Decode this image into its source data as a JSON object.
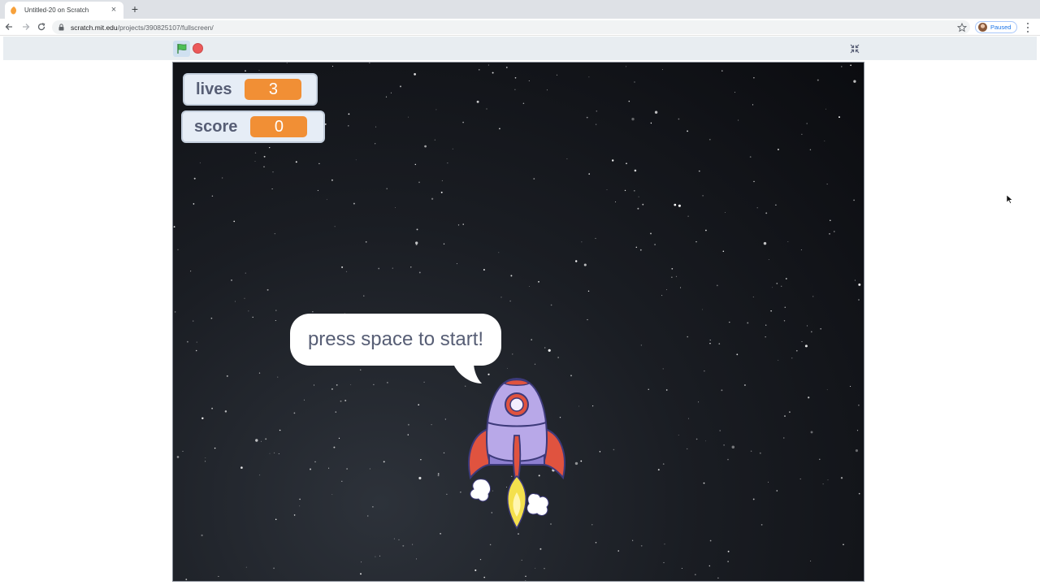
{
  "browser": {
    "tab_title": "Untitled-20 on Scratch",
    "url_host": "scratch.mit.edu",
    "url_path": "/projects/390825107/fullscreen/",
    "profile_label": "Paused"
  },
  "player": {
    "green_flag_color": "#4cbf56",
    "stop_color": "#ec5959"
  },
  "monitors": {
    "lives": {
      "label": "lives",
      "value": "3"
    },
    "score": {
      "label": "score",
      "value": "0"
    }
  },
  "sprite": {
    "speech": "press space to start!"
  },
  "colors": {
    "monitor_value_bg": "#f18f35",
    "monitor_bg": "#e6edf6",
    "rocket_body": "#b8a8e8",
    "rocket_fins": "#e0533f",
    "flame": "#f4e04d"
  }
}
